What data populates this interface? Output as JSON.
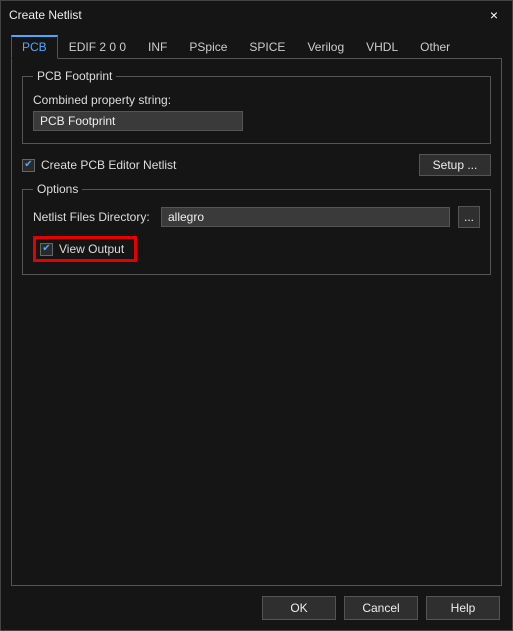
{
  "window": {
    "title": "Create Netlist",
    "close": "×"
  },
  "tabs": [
    {
      "label": "PCB",
      "active": true
    },
    {
      "label": "EDIF 2 0 0",
      "active": false
    },
    {
      "label": "INF",
      "active": false
    },
    {
      "label": "PSpice",
      "active": false
    },
    {
      "label": "SPICE",
      "active": false
    },
    {
      "label": "Verilog",
      "active": false
    },
    {
      "label": "VHDL",
      "active": false
    },
    {
      "label": "Other",
      "active": false
    }
  ],
  "footprint": {
    "legend": "PCB Footprint",
    "combined_label": "Combined property string:",
    "combined_value": "PCB Footprint"
  },
  "create_netlist": {
    "checked": true,
    "label": "Create PCB Editor Netlist"
  },
  "setup_button": "Setup ...",
  "options": {
    "legend": "Options",
    "dir_label": "Netlist Files Directory:",
    "dir_value": "allegro",
    "browse": "...",
    "view_output": {
      "checked": true,
      "label": "View Output"
    }
  },
  "footer": {
    "ok": "OK",
    "cancel": "Cancel",
    "help": "Help"
  }
}
